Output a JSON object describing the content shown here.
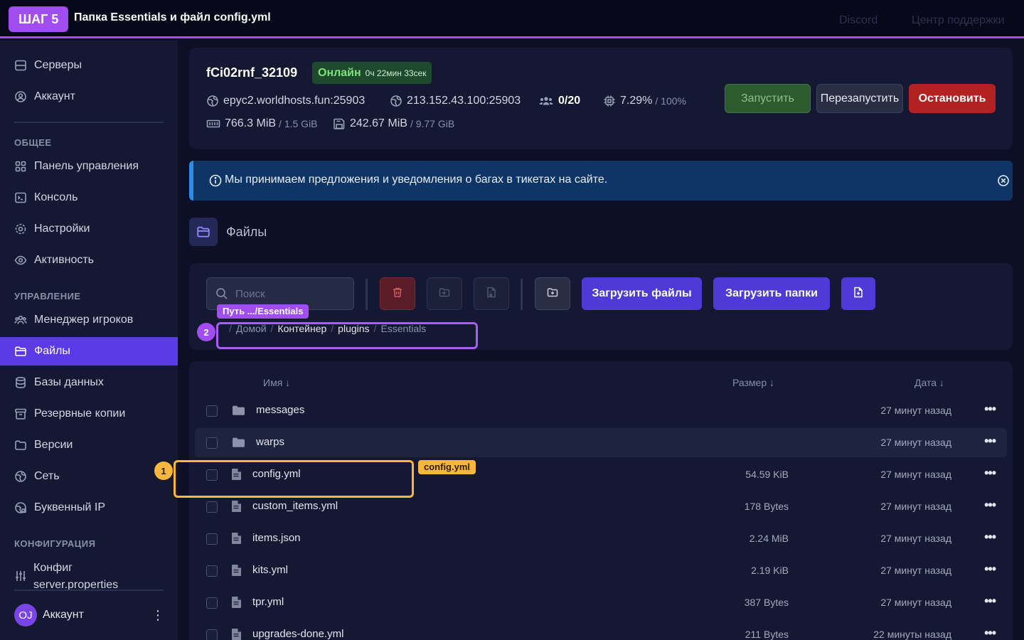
{
  "banner": {
    "step": "ШАГ 5",
    "title": "Папка Essentials и файл config.yml"
  },
  "header_links": {
    "discord": "Discord",
    "support": "Центр поддержки"
  },
  "sidebar": {
    "top_items": [
      {
        "label": "Серверы",
        "icon": "server-icon"
      },
      {
        "label": "Аккаунт",
        "icon": "user-circle-icon"
      }
    ],
    "sections": [
      {
        "title": "ОБЩЕЕ",
        "items": [
          {
            "label": "Панель управления",
            "icon": "grid-icon"
          },
          {
            "label": "Консоль",
            "icon": "terminal-icon"
          },
          {
            "label": "Настройки",
            "icon": "gear-icon"
          },
          {
            "label": "Активность",
            "icon": "eye-icon"
          }
        ]
      },
      {
        "title": "УПРАВЛЕНИЕ",
        "items": [
          {
            "label": "Менеджер игроков",
            "icon": "users-icon"
          },
          {
            "label": "Файлы",
            "icon": "folder-icon",
            "active": true
          },
          {
            "label": "Базы данных",
            "icon": "database-icon"
          },
          {
            "label": "Резервные копии",
            "icon": "archive-icon"
          },
          {
            "label": "Версии",
            "icon": "folder-open-icon"
          },
          {
            "label": "Сеть",
            "icon": "globe-icon"
          },
          {
            "label": "Буквенный IP",
            "icon": "globe-lock-icon"
          }
        ]
      },
      {
        "title": "КОНФИГУРАЦИЯ",
        "items": [
          {
            "label_line1": "Конфиг",
            "label_line2": "server.properties",
            "icon": "sliders-icon"
          }
        ]
      }
    ],
    "account": {
      "initials": "OJ",
      "name": "Аккаунт"
    }
  },
  "server": {
    "name": "fCi02rnf_32109",
    "status": "Онлайн",
    "uptime": "0ч 22мин 33сек",
    "address": "epyc2.worldhosts.fun:25903",
    "ip": "213.152.43.100:25903",
    "players": "0/20",
    "cpu": "7.29%",
    "cpu_limit": "/ 100%",
    "memory": "766.3 MiB",
    "memory_limit": "/ 1.5 GiB",
    "disk": "242.67 MiB",
    "disk_limit": "/ 9.77 GiB",
    "buttons": {
      "start": "Запустить",
      "restart": "Перезапустить",
      "stop": "Остановить"
    }
  },
  "alert": {
    "text": "Мы принимаем предложения и уведомления о багах в тикетах на сайте."
  },
  "files": {
    "title": "Файлы",
    "search_placeholder": "Поиск",
    "upload_files": "Загрузить файлы",
    "upload_folders": "Загрузить папки",
    "breadcrumb": [
      "Домой",
      "Контейнер",
      "plugins",
      "Essentials"
    ],
    "columns": {
      "name": "Имя ↓",
      "size": "Размер ↓",
      "date": "Дата ↓"
    },
    "rows": [
      {
        "name": "messages",
        "type": "folder",
        "size": "",
        "date": "27 минут назад"
      },
      {
        "name": "warps",
        "type": "folder",
        "size": "",
        "date": "27 минут назад"
      },
      {
        "name": "config.yml",
        "type": "file",
        "size": "54.59 KiB",
        "date": "27 минут назад"
      },
      {
        "name": "custom_items.yml",
        "type": "file",
        "size": "178 Bytes",
        "date": "27 минут назад"
      },
      {
        "name": "items.json",
        "type": "file",
        "size": "2.24 MiB",
        "date": "27 минут назад"
      },
      {
        "name": "kits.yml",
        "type": "file",
        "size": "2.19 KiB",
        "date": "27 минут назад"
      },
      {
        "name": "tpr.yml",
        "type": "file",
        "size": "387 Bytes",
        "date": "27 минут назад"
      },
      {
        "name": "upgrades-done.yml",
        "type": "file",
        "size": "211 Bytes",
        "date": "22 минуты назад"
      }
    ]
  },
  "annotations": {
    "path_label": "Путь .../Essentials",
    "path_number": "2",
    "file_label": "config.yml",
    "file_number": "1"
  }
}
